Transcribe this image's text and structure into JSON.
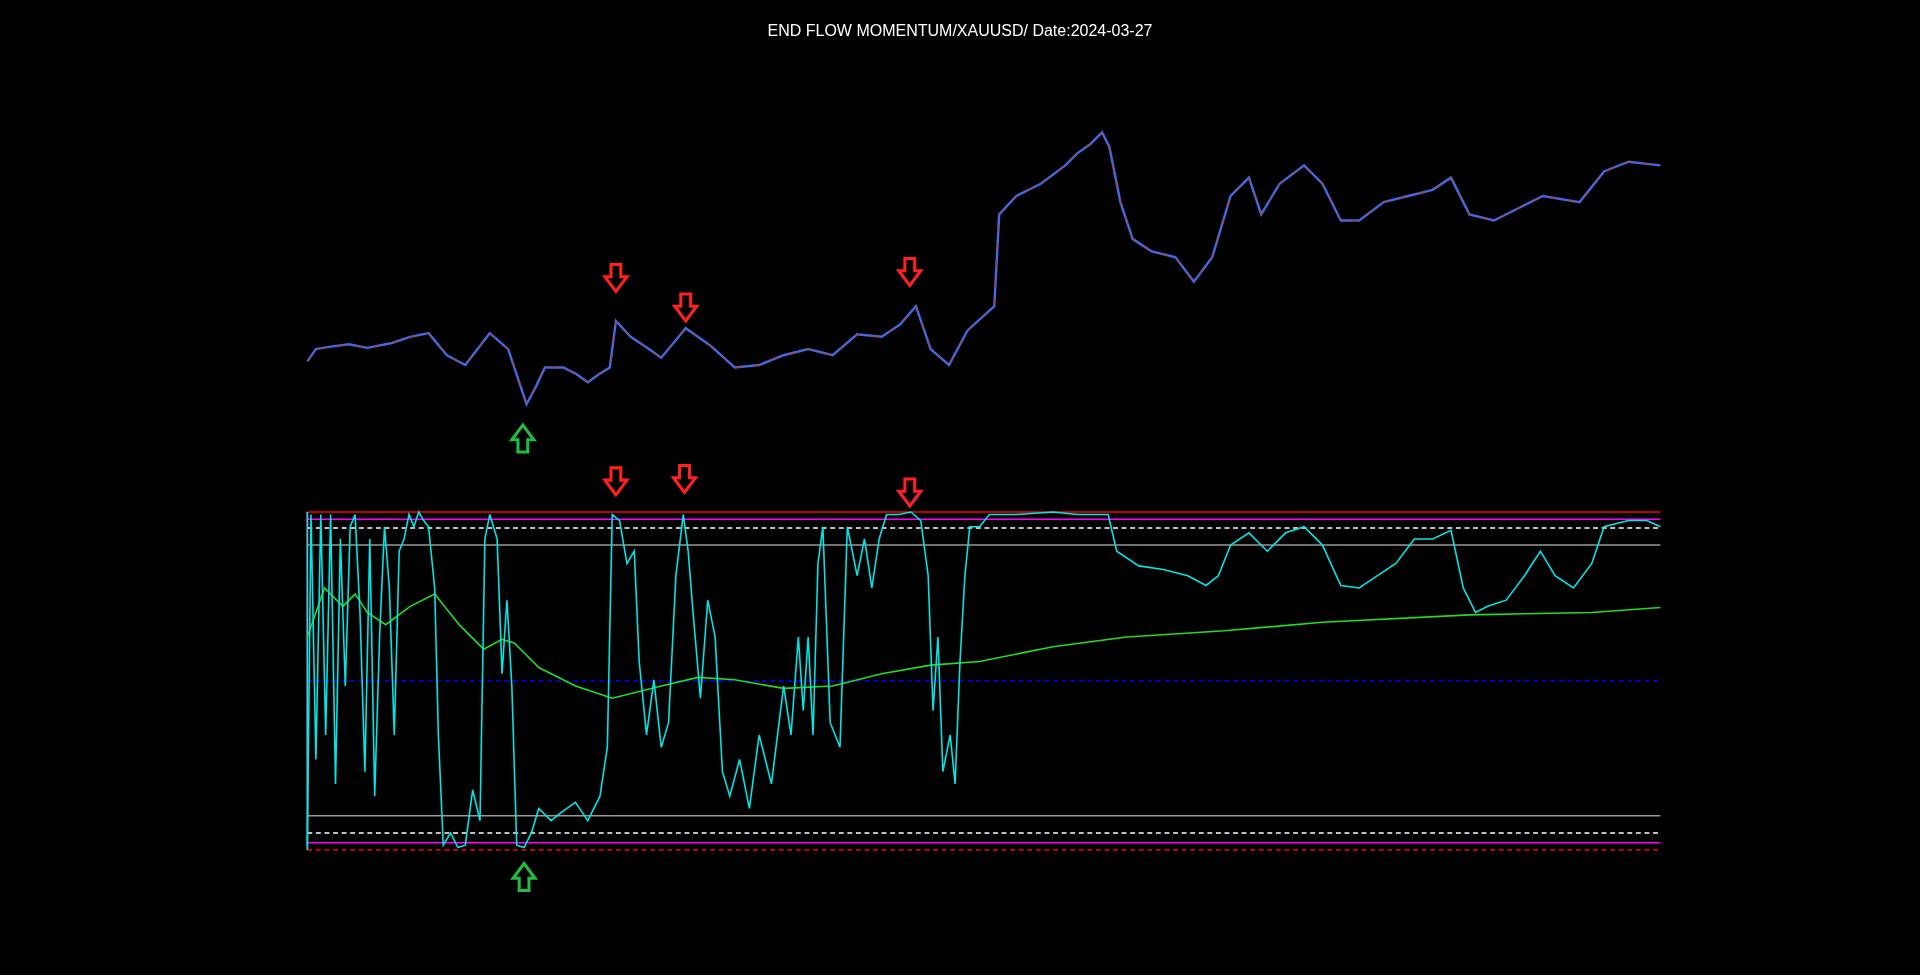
{
  "title": "END FLOW MOMENTUM/XAUUSD/ Date:2024-03-27"
}
